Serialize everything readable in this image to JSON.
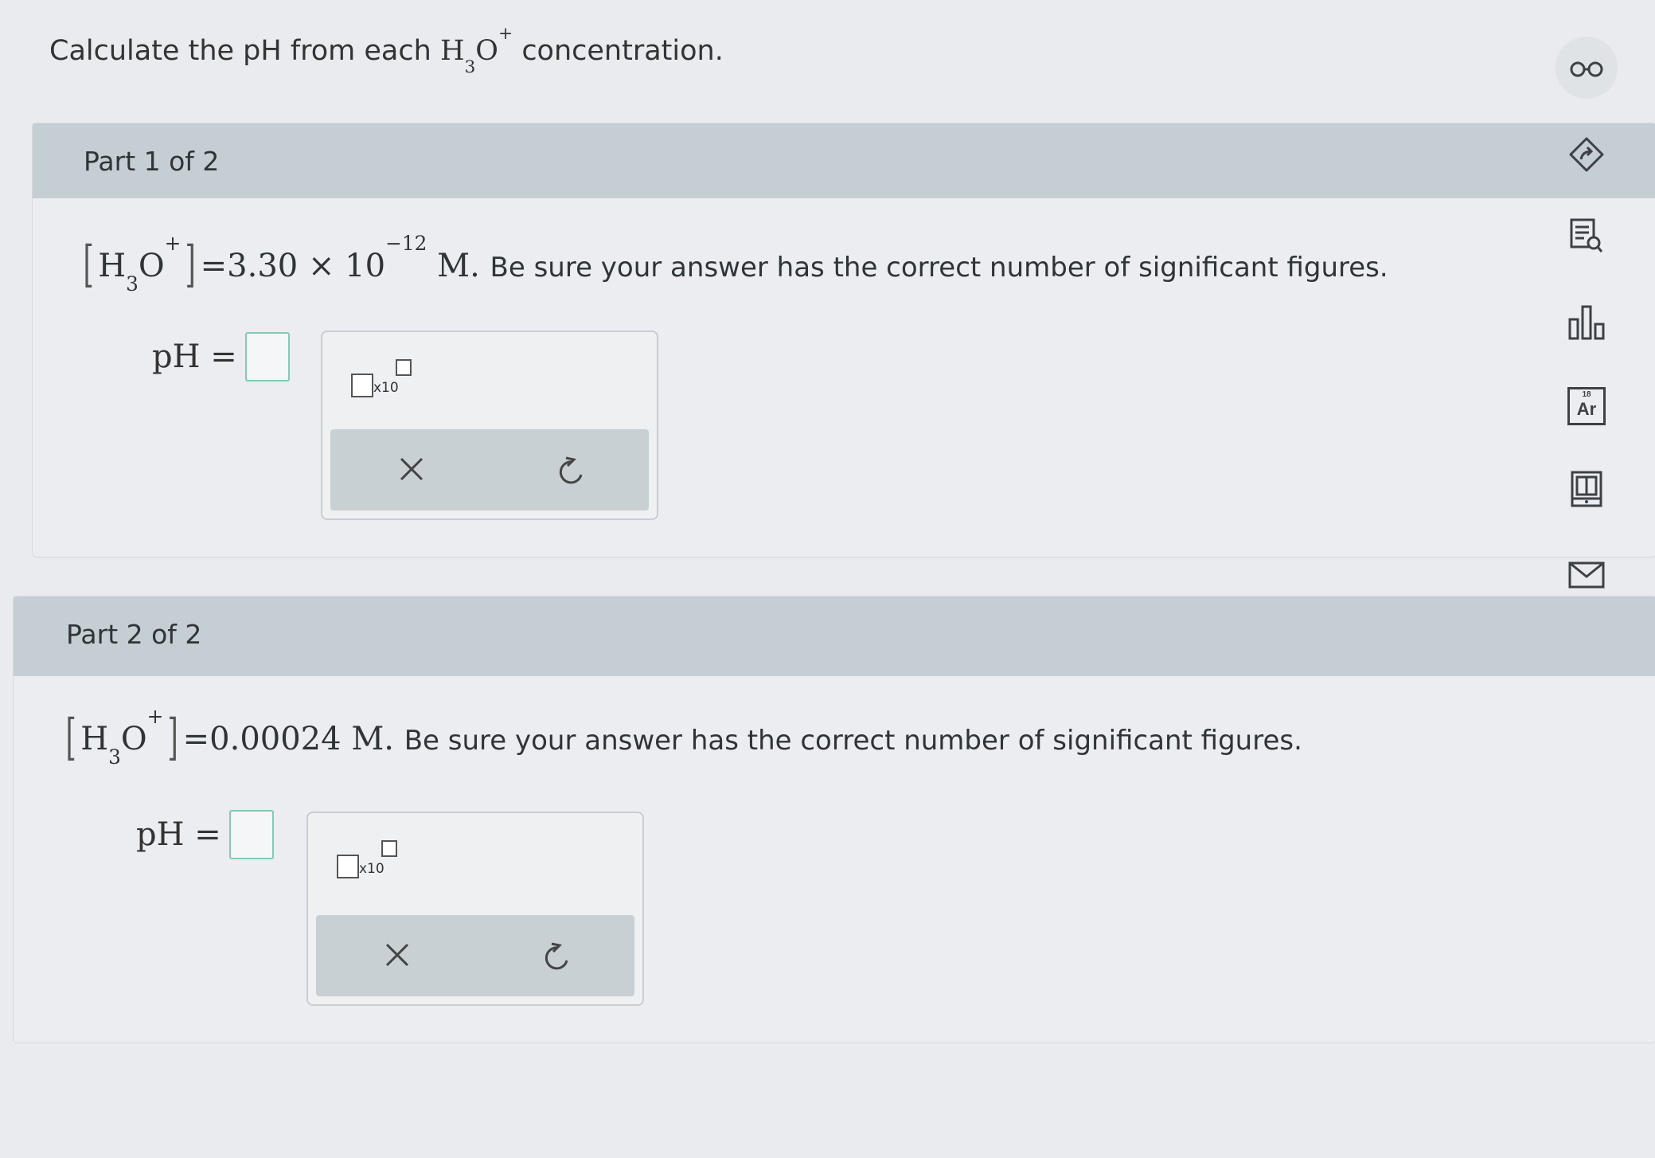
{
  "prompt": {
    "text_before": "Calculate the pH from each",
    "species_h": "H",
    "species_sub": "3",
    "species_o": "O",
    "species_sup": "+",
    "text_after": "concentration."
  },
  "parts": [
    {
      "header": "Part 1 of 2",
      "conc_h": "H",
      "conc_sub": "3",
      "conc_o": "O",
      "conc_sup": "+",
      "conc_value": "=3.30 × 10",
      "conc_exponent": "−12",
      "conc_unit": "M.",
      "instruction": "Be sure your answer has the correct number of significant figures.",
      "answer_label": "pH =",
      "x10_label": "x10"
    },
    {
      "header": "Part 2 of 2",
      "conc_h": "H",
      "conc_sub": "3",
      "conc_o": "O",
      "conc_sup": "+",
      "conc_value": "=0.00024",
      "conc_exponent": "",
      "conc_unit": "M.",
      "instruction": "Be sure your answer has the correct number of significant figures.",
      "answer_label": "pH =",
      "x10_label": "x10"
    }
  ],
  "sidebar": {
    "icons": [
      "reader-glasses-icon",
      "hint-arrow-icon",
      "calculator-list-icon",
      "data-chart-icon",
      "periodic-table-icon",
      "reference-card-icon",
      "message-envelope-icon"
    ],
    "periodic_number": "18",
    "periodic_symbol": "Ar"
  },
  "colors": {
    "header_bg": "#c5ced3",
    "answer_border": "#86c9b5",
    "page_bg": "#e9ebee"
  }
}
